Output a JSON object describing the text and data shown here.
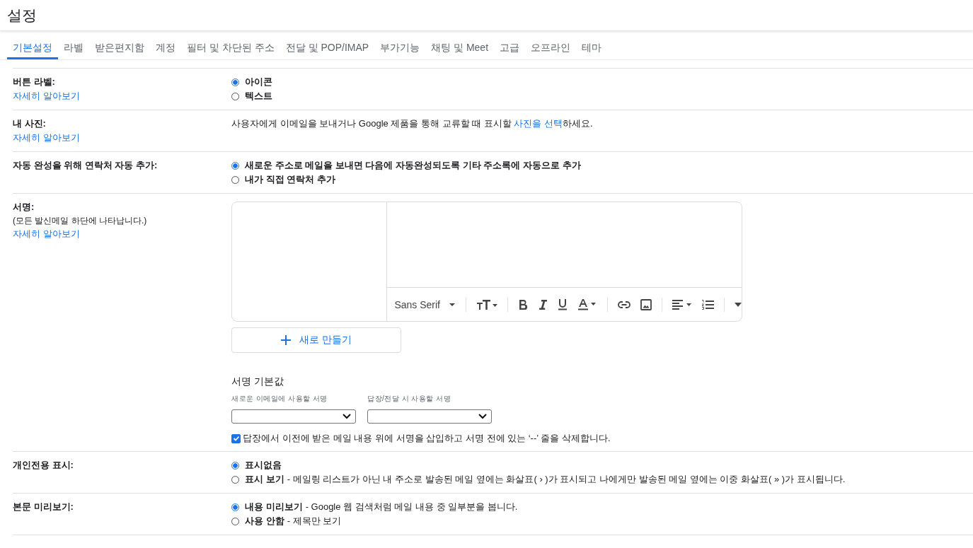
{
  "title": "설정",
  "tabs": [
    {
      "label": "기본설정",
      "selected": true
    },
    {
      "label": "라벨",
      "selected": false
    },
    {
      "label": "받은편지함",
      "selected": false
    },
    {
      "label": "계정",
      "selected": false
    },
    {
      "label": "필터 및 차단된 주소",
      "selected": false
    },
    {
      "label": "전달 및 POP/IMAP",
      "selected": false
    },
    {
      "label": "부가기능",
      "selected": false
    },
    {
      "label": "채팅 및 Meet",
      "selected": false
    },
    {
      "label": "고급",
      "selected": false
    },
    {
      "label": "오프라인",
      "selected": false
    },
    {
      "label": "테마",
      "selected": false
    }
  ],
  "sections": [
    {
      "kind": "radio",
      "label": "버튼 라벨:",
      "link": "자세히 알아보기",
      "options": [
        {
          "label": "아이콘",
          "selected": true
        },
        {
          "label": "텍스트",
          "selected": false
        }
      ]
    },
    {
      "kind": "text",
      "label": "내 사진:",
      "link": "자세히 알아보기",
      "before": "사용자에게 이메일을 보내거나 Google 제품을 통해 교류할 때 표시할 ",
      "action": "사진을 선택",
      "after": "하세요."
    },
    {
      "kind": "radio",
      "label": "자동 완성을 위해 연락처 자동 추가:",
      "options": [
        {
          "label": "새로운 주소로 메일을 보내면 다음에 자동완성되도록 기타 주소록에 자동으로 추가",
          "selected": true
        },
        {
          "label": "내가 직접 연락처 추가",
          "selected": false
        }
      ]
    },
    {
      "kind": "signature",
      "label": "서명:",
      "note": "(모든 발신메일 하단에 나타납니다.)",
      "link": "자세히 알아보기",
      "font": "Sans Serif",
      "create": "새로 만들기",
      "defaults_title": "서명 기본값",
      "new_label": "새로운 이메일에 사용할 서명",
      "reply_label": "답장/전달 시 사용할 서명",
      "insert_above": {
        "label": "답장에서 이전에 받은 메일 내용 위에 서명을 삽입하고 서명 전에 있는 ‘--’ 줄을 삭제합니다.",
        "checked": true
      }
    },
    {
      "kind": "radio",
      "label": "개인전용 표시:",
      "options": [
        {
          "label": "표시없음",
          "selected": true
        },
        {
          "label": "표시 보기",
          "description": "- 메일링 리스트가 아닌 내 주소로 발송된 메일 옆에는 화살표( › )가 표시되고 나에게만 발송된 메일 옆에는 이중 화살표( » )가 표시됩니다.",
          "selected": false
        }
      ]
    },
    {
      "kind": "radio",
      "label": "본문 미리보기:",
      "options": [
        {
          "label": "내용 미리보기",
          "description": "- Google 웹 검색처럼 메일 내용 중 일부분을 봅니다.",
          "selected": true
        },
        {
          "label": "사용 안함",
          "description": "- 제목만 보기",
          "selected": false
        }
      ]
    }
  ]
}
